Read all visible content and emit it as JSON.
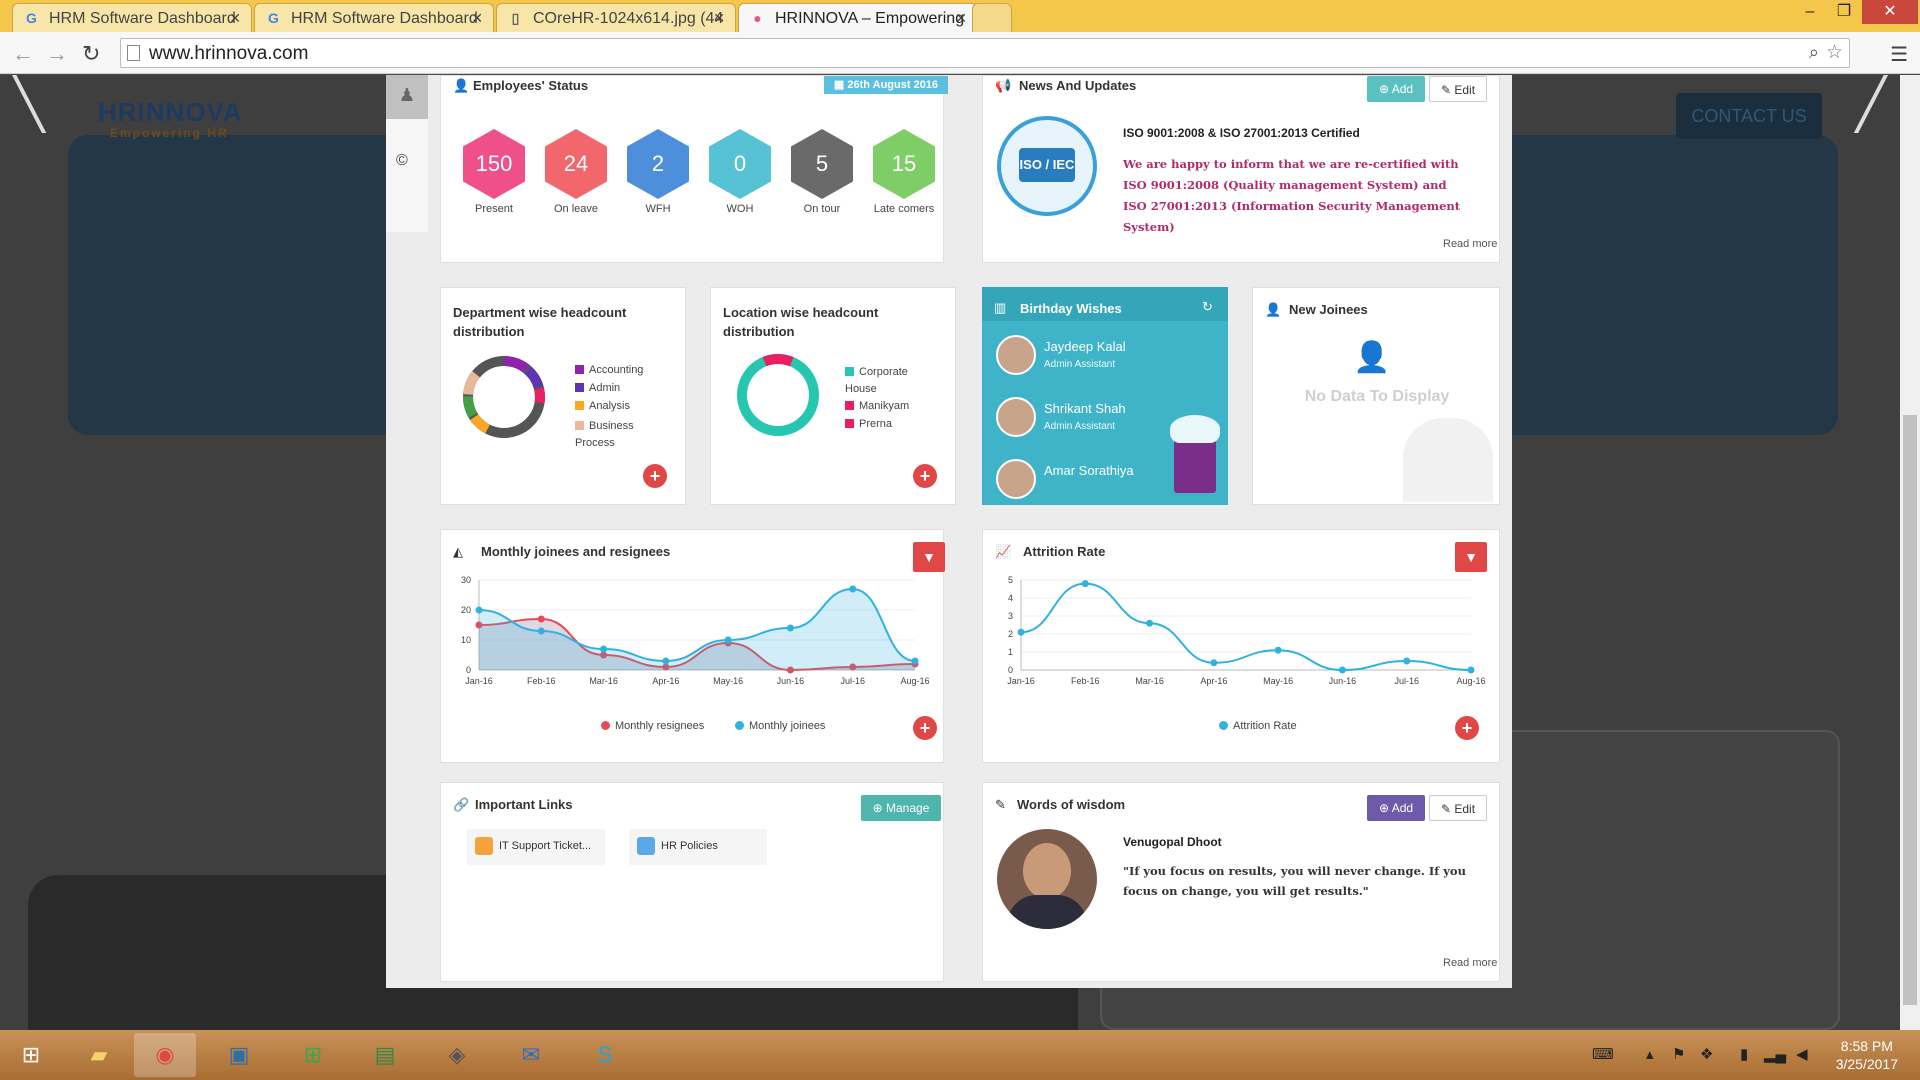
{
  "browser": {
    "tabs": [
      {
        "title": "HRM Software Dashboard"
      },
      {
        "title": "HRM Software Dashboard"
      },
      {
        "title": "COreHR-1024x614.jpg (44"
      },
      {
        "title": "HRINNOVA – Empowering"
      }
    ],
    "url": "www.hrinnova.com"
  },
  "site": {
    "logo": "HRINNOVA",
    "tagline": "Empowering HR",
    "contact_button": "CONTACT US"
  },
  "employees_status": {
    "title": "Employees' Status",
    "date_badge": "26th August 2016",
    "items": [
      {
        "value": "150",
        "label": "Present",
        "color": "#f0508a"
      },
      {
        "value": "24",
        "label": "On leave",
        "color": "#f2676c"
      },
      {
        "value": "2",
        "label": "WFH",
        "color": "#4e8fdb"
      },
      {
        "value": "0",
        "label": "WOH",
        "color": "#57c2d4"
      },
      {
        "value": "5",
        "label": "On tour",
        "color": "#6a6a6a"
      },
      {
        "value": "15",
        "label": "Late comers",
        "color": "#7fcd66"
      }
    ]
  },
  "news": {
    "title": "News And Updates",
    "add_label": "Add",
    "edit_label": "Edit",
    "headline": "ISO 9001:2008 & ISO 27001:2013 Certified",
    "body": "We are happy to inform that we are re-certified with ISO 9001:2008 (Quality management System) and ISO 27001:2013 (Information Security Management System)",
    "read_more": "Read more",
    "badge_text": "ISO / IEC"
  },
  "dept_headcount": {
    "title": "Department wise headcount distribution",
    "legend": [
      {
        "label": "Accounting",
        "color": "#8e24aa"
      },
      {
        "label": "Admin",
        "color": "#5e35b1"
      },
      {
        "label": "Analysis",
        "color": "#f9a825"
      },
      {
        "label": "Business Process",
        "color": "#e8b89a"
      }
    ]
  },
  "location_headcount": {
    "title": "Location wise headcount distribution",
    "legend": [
      {
        "label": "Corporate House",
        "color": "#26c6b0"
      },
      {
        "label": "Manikyam",
        "color": "#e91e63"
      },
      {
        "label": "Prerna",
        "color": "#e91e63"
      }
    ]
  },
  "birthday": {
    "title": "Birthday Wishes",
    "people": [
      {
        "name": "Jaydeep Kalal",
        "role": "Admin Assistant"
      },
      {
        "name": "Shrikant Shah",
        "role": "Admin Assistant"
      },
      {
        "name": "Amar Sorathiya",
        "role": ""
      }
    ]
  },
  "new_joinees": {
    "title": "New Joinees",
    "empty_text": "No Data To Display"
  },
  "monthly_chart": {
    "title": "Monthly joinees and resignees"
  },
  "attrition_chart": {
    "title": "Attrition Rate"
  },
  "important_links": {
    "title": "Important Links",
    "manage_label": "Manage",
    "links": [
      {
        "label": "IT Support Ticket..."
      },
      {
        "label": "HR Policies"
      }
    ]
  },
  "wisdom": {
    "title": "Words of wisdom",
    "add_label": "Add",
    "edit_label": "Edit",
    "author": "Venugopal Dhoot",
    "quote": "\"If you focus on results, you will never change. If you focus on change, you will get results.\"",
    "read_more": "Read more"
  },
  "taskbar": {
    "time": "8:58 PM",
    "date": "3/25/2017"
  },
  "chart_data": [
    {
      "type": "area",
      "title": "Monthly joinees and resignees",
      "categories": [
        "Jan-16",
        "Feb-16",
        "Mar-16",
        "Apr-16",
        "May-16",
        "Jun-16",
        "Jul-16",
        "Aug-16"
      ],
      "ylim": [
        0,
        30
      ],
      "yticks": [
        0,
        10,
        20,
        30
      ],
      "series": [
        {
          "name": "Monthly resignees",
          "color": "#e84a55",
          "values": [
            15,
            17,
            5,
            1,
            9,
            0,
            1,
            2
          ]
        },
        {
          "name": "Monthly joinees",
          "color": "#2fb2e0",
          "values": [
            20,
            13,
            7,
            3,
            10,
            14,
            27,
            3
          ]
        }
      ],
      "legend": "bottom"
    },
    {
      "type": "line",
      "title": "Attrition Rate",
      "categories": [
        "Jan-16",
        "Feb-16",
        "Mar-16",
        "Apr-16",
        "May-16",
        "Jun-16",
        "Jul-16",
        "Aug-16"
      ],
      "ylim": [
        0,
        5
      ],
      "yticks": [
        0,
        1,
        2,
        3,
        4,
        5
      ],
      "series": [
        {
          "name": "Attrition Rate",
          "color": "#2fb2e0",
          "values": [
            2.1,
            4.8,
            2.6,
            0.4,
            1.1,
            0.0,
            0.5,
            0.0
          ]
        }
      ],
      "legend": "bottom"
    },
    {
      "type": "pie",
      "title": "Department wise headcount distribution",
      "categories": [
        "Accounting",
        "Admin",
        "Analysis",
        "Business Process"
      ],
      "values": [
        12,
        10,
        8,
        70
      ]
    },
    {
      "type": "pie",
      "title": "Location wise headcount distribution",
      "categories": [
        "Corporate House",
        "Manikyam",
        "Prerna"
      ],
      "values": [
        88,
        6,
        6
      ]
    }
  ]
}
